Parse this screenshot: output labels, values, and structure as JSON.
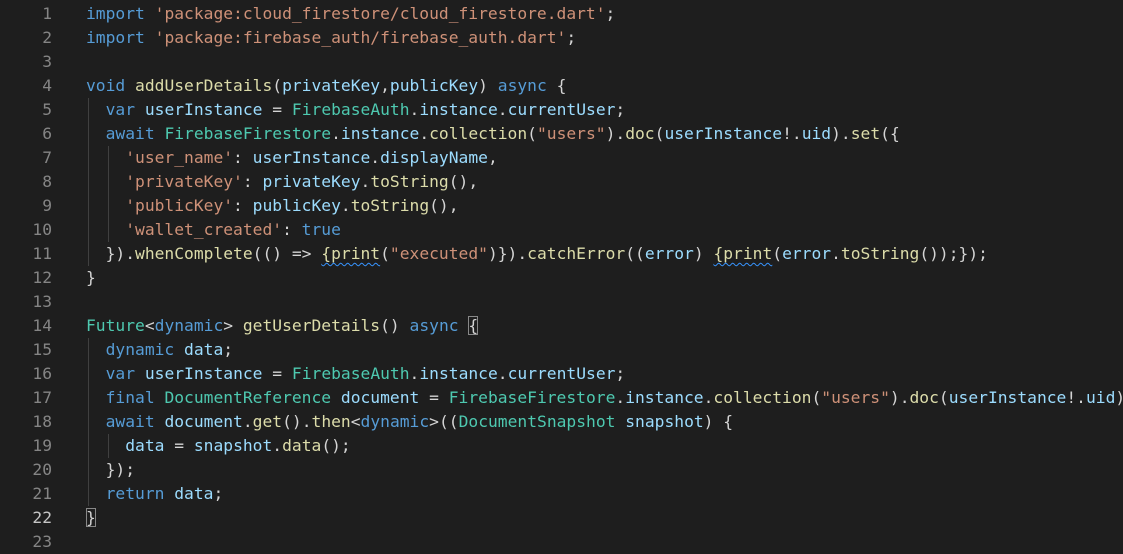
{
  "editor": {
    "lines": [
      {
        "number": "1",
        "tokens": [
          {
            "t": "import",
            "c": "kw"
          },
          {
            "t": " ",
            "c": "pl"
          },
          {
            "t": "'package:cloud_firestore/cloud_firestore.dart'",
            "c": "str"
          },
          {
            "t": ";",
            "c": "pl"
          }
        ]
      },
      {
        "number": "2",
        "tokens": [
          {
            "t": "import",
            "c": "kw"
          },
          {
            "t": " ",
            "c": "pl"
          },
          {
            "t": "'package:firebase_auth/firebase_auth.dart'",
            "c": "str"
          },
          {
            "t": ";",
            "c": "pl"
          }
        ]
      },
      {
        "number": "3",
        "tokens": []
      },
      {
        "number": "4",
        "tokens": [
          {
            "t": "void",
            "c": "kw"
          },
          {
            "t": " ",
            "c": "pl"
          },
          {
            "t": "addUserDetails",
            "c": "fn"
          },
          {
            "t": "(",
            "c": "pl"
          },
          {
            "t": "privateKey",
            "c": "var"
          },
          {
            "t": ",",
            "c": "pl"
          },
          {
            "t": "publicKey",
            "c": "var"
          },
          {
            "t": ") ",
            "c": "pl"
          },
          {
            "t": "async",
            "c": "kw"
          },
          {
            "t": " {",
            "c": "pl"
          }
        ]
      },
      {
        "number": "5",
        "tokens": [
          {
            "t": "  ",
            "c": "pl"
          },
          {
            "t": "var",
            "c": "kw"
          },
          {
            "t": " ",
            "c": "pl"
          },
          {
            "t": "userInstance",
            "c": "var"
          },
          {
            "t": " = ",
            "c": "pl"
          },
          {
            "t": "FirebaseAuth",
            "c": "ty"
          },
          {
            "t": ".",
            "c": "pl"
          },
          {
            "t": "instance",
            "c": "var"
          },
          {
            "t": ".",
            "c": "pl"
          },
          {
            "t": "currentUser",
            "c": "var"
          },
          {
            "t": ";",
            "c": "pl"
          }
        ]
      },
      {
        "number": "6",
        "tokens": [
          {
            "t": "  ",
            "c": "pl"
          },
          {
            "t": "await",
            "c": "kw"
          },
          {
            "t": " ",
            "c": "pl"
          },
          {
            "t": "FirebaseFirestore",
            "c": "ty"
          },
          {
            "t": ".",
            "c": "pl"
          },
          {
            "t": "instance",
            "c": "var"
          },
          {
            "t": ".",
            "c": "pl"
          },
          {
            "t": "collection",
            "c": "fn"
          },
          {
            "t": "(",
            "c": "pl"
          },
          {
            "t": "\"users\"",
            "c": "str"
          },
          {
            "t": ").",
            "c": "pl"
          },
          {
            "t": "doc",
            "c": "fn"
          },
          {
            "t": "(",
            "c": "pl"
          },
          {
            "t": "userInstance",
            "c": "var"
          },
          {
            "t": "!.",
            "c": "pl"
          },
          {
            "t": "uid",
            "c": "var"
          },
          {
            "t": ").",
            "c": "pl"
          },
          {
            "t": "set",
            "c": "fn"
          },
          {
            "t": "({",
            "c": "pl"
          }
        ]
      },
      {
        "number": "7",
        "tokens": [
          {
            "t": "    ",
            "c": "pl"
          },
          {
            "t": "'user_name'",
            "c": "str"
          },
          {
            "t": ": ",
            "c": "pl"
          },
          {
            "t": "userInstance",
            "c": "var"
          },
          {
            "t": ".",
            "c": "pl"
          },
          {
            "t": "displayName",
            "c": "var"
          },
          {
            "t": ",",
            "c": "pl"
          }
        ]
      },
      {
        "number": "8",
        "tokens": [
          {
            "t": "    ",
            "c": "pl"
          },
          {
            "t": "'privateKey'",
            "c": "str"
          },
          {
            "t": ": ",
            "c": "pl"
          },
          {
            "t": "privateKey",
            "c": "var"
          },
          {
            "t": ".",
            "c": "pl"
          },
          {
            "t": "toString",
            "c": "fn"
          },
          {
            "t": "(),",
            "c": "pl"
          }
        ]
      },
      {
        "number": "9",
        "tokens": [
          {
            "t": "    ",
            "c": "pl"
          },
          {
            "t": "'publicKey'",
            "c": "str"
          },
          {
            "t": ": ",
            "c": "pl"
          },
          {
            "t": "publicKey",
            "c": "var"
          },
          {
            "t": ".",
            "c": "pl"
          },
          {
            "t": "toString",
            "c": "fn"
          },
          {
            "t": "(),",
            "c": "pl"
          }
        ]
      },
      {
        "number": "10",
        "tokens": [
          {
            "t": "    ",
            "c": "pl"
          },
          {
            "t": "'wallet_created'",
            "c": "str"
          },
          {
            "t": ": ",
            "c": "pl"
          },
          {
            "t": "true",
            "c": "kw"
          }
        ]
      },
      {
        "number": "11",
        "tokens": [
          {
            "t": "  }).",
            "c": "pl"
          },
          {
            "t": "whenComplete",
            "c": "fn"
          },
          {
            "t": "(() => ",
            "c": "pl"
          },
          {
            "t": "{print",
            "c": "fn",
            "sq": true
          },
          {
            "t": "(",
            "c": "pl"
          },
          {
            "t": "\"executed\"",
            "c": "str"
          },
          {
            "t": ")}).",
            "c": "pl"
          },
          {
            "t": "catchError",
            "c": "fn"
          },
          {
            "t": "((",
            "c": "pl"
          },
          {
            "t": "error",
            "c": "var"
          },
          {
            "t": ") ",
            "c": "pl"
          },
          {
            "t": "{print",
            "c": "fn",
            "sq": true
          },
          {
            "t": "(",
            "c": "pl"
          },
          {
            "t": "error",
            "c": "var"
          },
          {
            "t": ".",
            "c": "pl"
          },
          {
            "t": "toString",
            "c": "fn"
          },
          {
            "t": "());});",
            "c": "pl"
          }
        ]
      },
      {
        "number": "12",
        "tokens": [
          {
            "t": "}",
            "c": "pl"
          }
        ]
      },
      {
        "number": "13",
        "tokens": []
      },
      {
        "number": "14",
        "tokens": [
          {
            "t": "Future",
            "c": "ty"
          },
          {
            "t": "<",
            "c": "pl"
          },
          {
            "t": "dynamic",
            "c": "kw"
          },
          {
            "t": "> ",
            "c": "pl"
          },
          {
            "t": "getUserDetails",
            "c": "fn"
          },
          {
            "t": "() ",
            "c": "pl"
          },
          {
            "t": "async",
            "c": "kw"
          },
          {
            "t": " ",
            "c": "pl"
          },
          {
            "t": "{",
            "c": "pl",
            "br": true
          }
        ]
      },
      {
        "number": "15",
        "tokens": [
          {
            "t": "  ",
            "c": "pl"
          },
          {
            "t": "dynamic",
            "c": "kw"
          },
          {
            "t": " ",
            "c": "pl"
          },
          {
            "t": "data",
            "c": "var"
          },
          {
            "t": ";",
            "c": "pl"
          }
        ]
      },
      {
        "number": "16",
        "tokens": [
          {
            "t": "  ",
            "c": "pl"
          },
          {
            "t": "var",
            "c": "kw"
          },
          {
            "t": " ",
            "c": "pl"
          },
          {
            "t": "userInstance",
            "c": "var"
          },
          {
            "t": " = ",
            "c": "pl"
          },
          {
            "t": "FirebaseAuth",
            "c": "ty"
          },
          {
            "t": ".",
            "c": "pl"
          },
          {
            "t": "instance",
            "c": "var"
          },
          {
            "t": ".",
            "c": "pl"
          },
          {
            "t": "currentUser",
            "c": "var"
          },
          {
            "t": ";",
            "c": "pl"
          }
        ]
      },
      {
        "number": "17",
        "tokens": [
          {
            "t": "  ",
            "c": "pl"
          },
          {
            "t": "final",
            "c": "kw"
          },
          {
            "t": " ",
            "c": "pl"
          },
          {
            "t": "DocumentReference",
            "c": "ty"
          },
          {
            "t": " ",
            "c": "pl"
          },
          {
            "t": "document",
            "c": "var"
          },
          {
            "t": " = ",
            "c": "pl"
          },
          {
            "t": "FirebaseFirestore",
            "c": "ty"
          },
          {
            "t": ".",
            "c": "pl"
          },
          {
            "t": "instance",
            "c": "var"
          },
          {
            "t": ".",
            "c": "pl"
          },
          {
            "t": "collection",
            "c": "fn"
          },
          {
            "t": "(",
            "c": "pl"
          },
          {
            "t": "\"users\"",
            "c": "str"
          },
          {
            "t": ").",
            "c": "pl"
          },
          {
            "t": "doc",
            "c": "fn"
          },
          {
            "t": "(",
            "c": "pl"
          },
          {
            "t": "userInstance",
            "c": "var"
          },
          {
            "t": "!.",
            "c": "pl"
          },
          {
            "t": "uid",
            "c": "var"
          },
          {
            "t": ");",
            "c": "pl"
          }
        ]
      },
      {
        "number": "18",
        "tokens": [
          {
            "t": "  ",
            "c": "pl"
          },
          {
            "t": "await",
            "c": "kw"
          },
          {
            "t": " ",
            "c": "pl"
          },
          {
            "t": "document",
            "c": "var"
          },
          {
            "t": ".",
            "c": "pl"
          },
          {
            "t": "get",
            "c": "fn"
          },
          {
            "t": "().",
            "c": "pl"
          },
          {
            "t": "then",
            "c": "fn"
          },
          {
            "t": "<",
            "c": "pl"
          },
          {
            "t": "dynamic",
            "c": "kw"
          },
          {
            "t": ">((",
            "c": "pl"
          },
          {
            "t": "DocumentSnapshot",
            "c": "ty"
          },
          {
            "t": " ",
            "c": "pl"
          },
          {
            "t": "snapshot",
            "c": "var"
          },
          {
            "t": ") {",
            "c": "pl"
          }
        ]
      },
      {
        "number": "19",
        "tokens": [
          {
            "t": "    ",
            "c": "pl"
          },
          {
            "t": "data",
            "c": "var"
          },
          {
            "t": " = ",
            "c": "pl"
          },
          {
            "t": "snapshot",
            "c": "var"
          },
          {
            "t": ".",
            "c": "pl"
          },
          {
            "t": "data",
            "c": "fn"
          },
          {
            "t": "();",
            "c": "pl"
          }
        ]
      },
      {
        "number": "20",
        "tokens": [
          {
            "t": "  });",
            "c": "pl"
          }
        ]
      },
      {
        "number": "21",
        "tokens": [
          {
            "t": "  ",
            "c": "pl"
          },
          {
            "t": "return",
            "c": "kw"
          },
          {
            "t": " ",
            "c": "pl"
          },
          {
            "t": "data",
            "c": "var"
          },
          {
            "t": ";",
            "c": "pl"
          }
        ]
      },
      {
        "number": "22",
        "active": true,
        "tokens": [
          {
            "t": "}",
            "c": "pl",
            "br": true
          }
        ]
      },
      {
        "number": "23",
        "tokens": []
      }
    ]
  }
}
